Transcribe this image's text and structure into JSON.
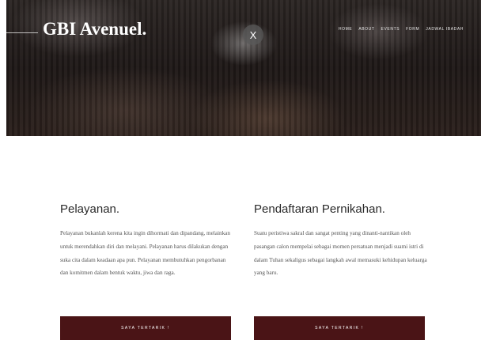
{
  "header": {
    "logo": "GBI Avenuel.",
    "close_label": "X",
    "nav": [
      "HOME",
      "ABOUT",
      "EVENTS",
      "FORM",
      "JADWAL IBADAH"
    ]
  },
  "sections": [
    {
      "title": "Pelayanan.",
      "paragraph": "Pelayanan bukanlah kerena kita ingin dihormati dan dipandang, melainkan untuk merendahkan diri dan melayani. Pelayanan harus dilakukan dengan suka cita dalam keadaan apa pun. Pelayanan membutuhkan pengorbanan dan komitmen dalam bentuk waktu, jiwa dan raga.",
      "button": "SAYA TERTARIK !"
    },
    {
      "title": "Pendaftaran Pernikahan.",
      "paragraph": "Suatu peristiwa sakral dan sangat penting yang dinanti-nantikan oleh pasangan calon mempelai sebagai momen persatuan menjadi suami istri di dalam Tuhan sekaligus sebagai langkah awal memasuki kehidupan keluarga yang baru.",
      "button": "SAYA TERTARIK !"
    }
  ]
}
